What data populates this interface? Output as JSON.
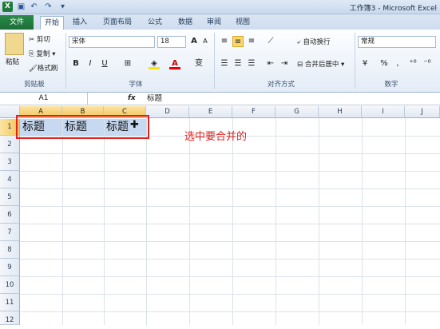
{
  "window": {
    "title": "工作簿3 - Microsoft Excel",
    "quick_access": [
      "save-icon",
      "undo-icon",
      "redo-icon",
      "customize-icon"
    ]
  },
  "tabs": [
    "文件",
    "开始",
    "插入",
    "页面布局",
    "公式",
    "数据",
    "审阅",
    "视图"
  ],
  "active_tab": "开始",
  "ribbon": {
    "clipboard": {
      "paste": "粘贴",
      "cut": "剪切",
      "copy": "复制",
      "format_painter": "格式刷",
      "label": "剪贴板"
    },
    "font": {
      "font_name": "宋体",
      "font_size": "18",
      "bold": "B",
      "italic": "I",
      "underline": "U",
      "grow": "A",
      "shrink": "A",
      "wen": "变",
      "label": "字体"
    },
    "alignment": {
      "wrap": "自动换行",
      "merge": "合并后居中",
      "label": "对齐方式"
    },
    "number": {
      "format": "常规",
      "percent": "%",
      "comma": ",",
      "label": "数字"
    }
  },
  "formula_bar": {
    "name_box": "A1",
    "fx": "fx",
    "content": "标题"
  },
  "grid": {
    "columns": [
      "A",
      "B",
      "C",
      "D",
      "E",
      "F",
      "G",
      "H",
      "I",
      "J"
    ],
    "selected_columns": [
      "A",
      "B",
      "C"
    ],
    "rows": [
      "1",
      "2",
      "3",
      "4",
      "5",
      "6",
      "7",
      "8",
      "9",
      "10",
      "11",
      "12"
    ],
    "selected_row": "1",
    "cells": {
      "A1": "标题",
      "B1": "标题",
      "C1": "标题"
    }
  },
  "annotation": "选中要合并的",
  "colors": {
    "file_tab": "#1c6e37",
    "selection": "#c7d9f1",
    "annotation_red": "#e0211d"
  }
}
